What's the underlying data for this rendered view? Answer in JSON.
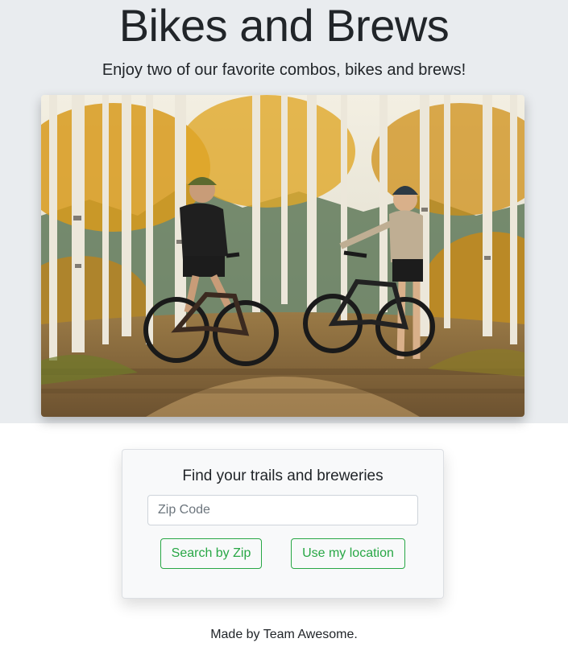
{
  "header": {
    "title": "Bikes and Brews",
    "subtitle": "Enjoy two of our favorite combos, bikes and brews!"
  },
  "hero_image": {
    "subject": "two mountain bikers with bikes on a trail among autumn aspen trees"
  },
  "search_card": {
    "title": "Find your trails and breweries",
    "zip_placeholder": "Zip Code",
    "zip_value": "",
    "search_by_zip_label": "Search by Zip",
    "use_location_label": "Use my location"
  },
  "footer": {
    "text": "Made by Team Awesome."
  },
  "colors": {
    "jumbotron_bg": "#e9ecef",
    "card_bg": "#f8f9fa",
    "button_accent": "#28a745",
    "text": "#212529"
  }
}
